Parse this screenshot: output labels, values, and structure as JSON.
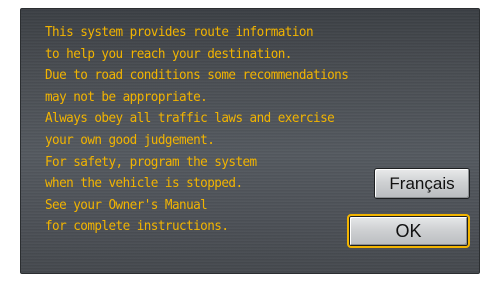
{
  "message_lines": [
    "This system provides route information",
    "to help you reach your destination.",
    "Due to road conditions some recommendations",
    "may not be appropriate.",
    "Always obey all traffic laws and exercise",
    "your own good judgement.",
    "For safety, program the system",
    "when the vehicle is stopped.",
    "See your Owner's Manual",
    "for complete instructions."
  ],
  "buttons": {
    "francais_label": "Français",
    "ok_label": "OK"
  },
  "colors": {
    "text": "#f2b400",
    "focus_outline": "#f2b400",
    "background": "#4a4e53"
  }
}
